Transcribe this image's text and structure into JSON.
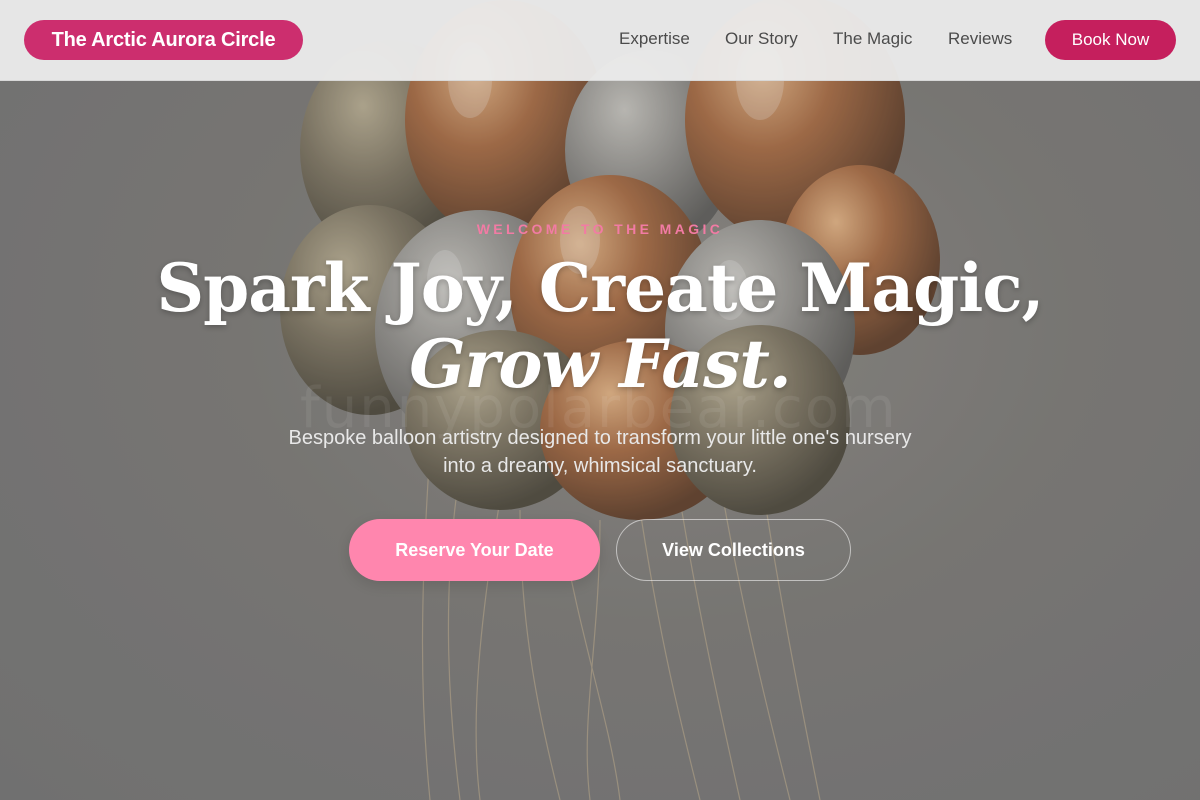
{
  "header": {
    "brand": "The Arctic Aurora Circle",
    "nav": [
      {
        "label": "Expertise"
      },
      {
        "label": "Our Story"
      },
      {
        "label": "The Magic"
      },
      {
        "label": "Reviews"
      }
    ],
    "cta": "Book Now"
  },
  "hero": {
    "eyebrow": "WELCOME TO THE MAGIC",
    "headline_line1": "Spark Joy, Create Magic,",
    "headline_line2": "Grow Fast.",
    "subtext": "Bespoke balloon artistry designed to transform your little one's nursery into a dreamy, whimsical sanctuary.",
    "primary_button": "Reserve Your Date",
    "secondary_button": "View Collections",
    "watermark": "funnypolarbear.com",
    "background_image": "gold-balloon-bouquet"
  },
  "colors": {
    "brand": "#cc2e6e",
    "cta": "#c51f5d",
    "accent_pink": "#ff86ae",
    "eyebrow": "#f27ba4"
  }
}
